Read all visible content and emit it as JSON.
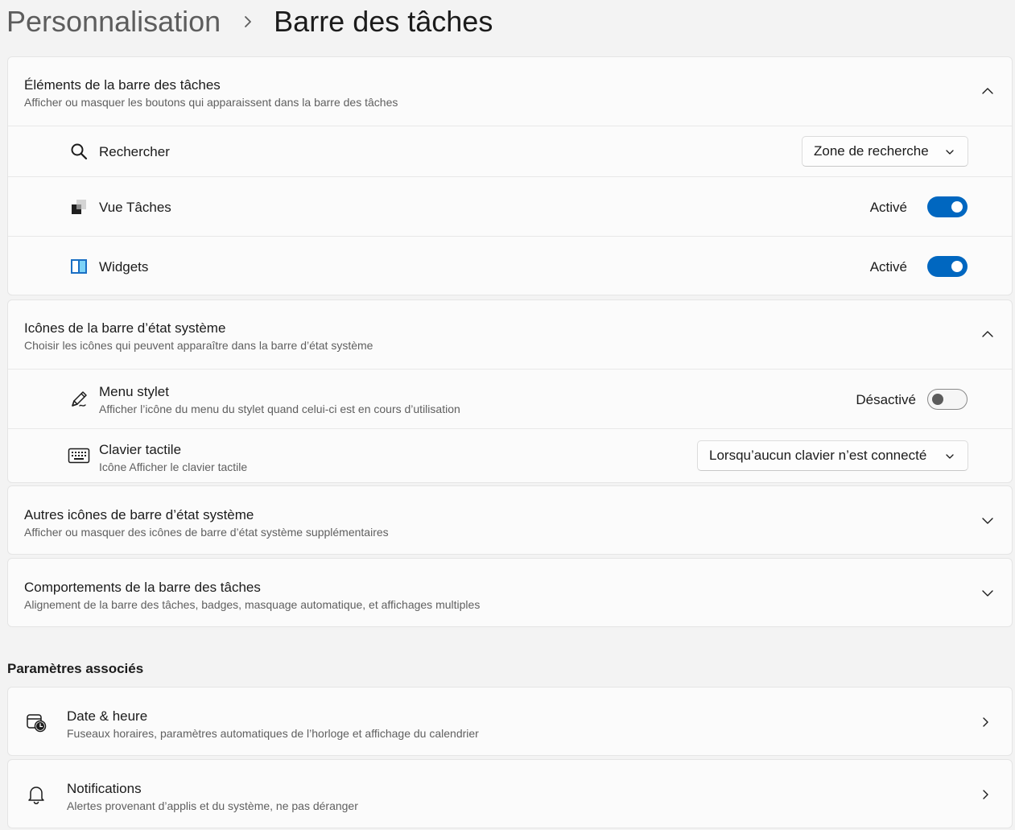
{
  "breadcrumb": {
    "parent": "Personnalisation",
    "current": "Barre des tâches"
  },
  "taskbar_items": {
    "title": "Éléments de la barre des tâches",
    "subtitle": "Afficher ou masquer les boutons qui apparaissent dans la barre des tâches",
    "expanded": true,
    "rows": {
      "search": {
        "label": "Rechercher",
        "value": "Zone de recherche"
      },
      "taskview": {
        "label": "Vue Tâches",
        "state": "Activé",
        "on": true
      },
      "widgets": {
        "label": "Widgets",
        "state": "Activé",
        "on": true
      }
    }
  },
  "tray_icons": {
    "title": "Icônes de la barre d’état système",
    "subtitle": "Choisir les icônes qui peuvent apparaître dans la barre d’état système",
    "expanded": true,
    "rows": {
      "pen": {
        "label": "Menu stylet",
        "sublabel": "Afficher l’icône du menu du stylet quand celui-ci est en cours d’utilisation",
        "state": "Désactivé",
        "on": false
      },
      "keyboard": {
        "label": "Clavier tactile",
        "sublabel": "Icône Afficher le clavier tactile",
        "value": "Lorsqu’aucun clavier n’est connecté"
      }
    }
  },
  "other_tray": {
    "title": "Autres icônes de barre d’état système",
    "subtitle": "Afficher ou masquer des icônes de barre d’état système supplémentaires",
    "expanded": false
  },
  "behaviors": {
    "title": "Comportements de la barre des tâches",
    "subtitle": "Alignement de la barre des tâches, badges, masquage automatique, et affichages multiples",
    "expanded": false
  },
  "related": {
    "heading": "Paramètres associés",
    "items": [
      {
        "title": "Date & heure",
        "subtitle": "Fuseaux horaires, paramètres automatiques de l’horloge et affichage du calendrier",
        "icon": "calendar-clock-icon"
      },
      {
        "title": "Notifications",
        "subtitle": "Alertes provenant d’applis et du système, ne pas déranger",
        "icon": "bell-icon"
      }
    ]
  },
  "colors": {
    "accent": "#0067c0",
    "background": "#f3f3f3",
    "card": "#fbfbfb"
  }
}
